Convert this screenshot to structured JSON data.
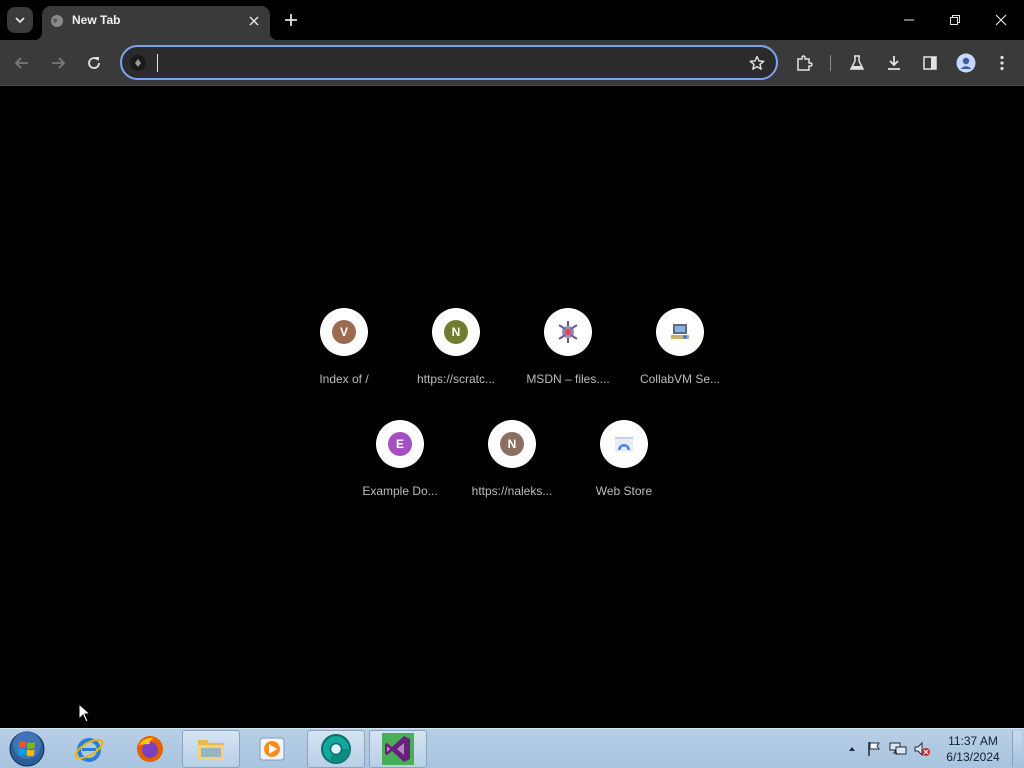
{
  "tab": {
    "title": "New Tab",
    "favicon": "globe-icon"
  },
  "omnibox": {
    "value": "",
    "placeholder": ""
  },
  "shortcuts": [
    {
      "label": "Index of /",
      "letter": "V",
      "color": "#9b6a50"
    },
    {
      "label": "https://scratc...",
      "letter": "N",
      "color": "#6d7f2e"
    },
    {
      "label": "MSDN – files....",
      "icon": "msdn-icon"
    },
    {
      "label": "CollabVM Se...",
      "icon": "collabvm-icon"
    },
    {
      "label": "Example Do...",
      "letter": "E",
      "color": "#a44fc2"
    },
    {
      "label": "https://naleks...",
      "letter": "N",
      "color": "#8d6e63"
    },
    {
      "label": "Web Store",
      "icon": "web-store-icon"
    }
  ],
  "taskbar": {
    "apps": [
      "internet-explorer-icon",
      "firefox-icon",
      "file-explorer-icon",
      "media-player-icon",
      "chrome-canary-icon",
      "visual-studio-icon"
    ],
    "clock": {
      "time": "11:37 AM",
      "date": "6/13/2024"
    }
  },
  "colors": {
    "accent": "#7ca3f0",
    "toolbar": "#3a3a3a",
    "background": "#000000"
  }
}
